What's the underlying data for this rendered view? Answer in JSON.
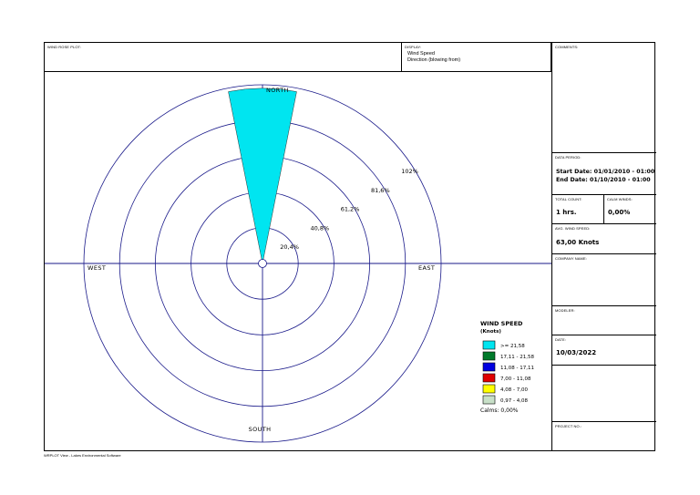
{
  "header": {
    "plot_caption": "WIND ROSE PLOT:",
    "display_caption": "DISPLAY:",
    "display_line1": "Wind Speed",
    "display_line2": "Direction (blowing from)"
  },
  "side": {
    "comments_caption": "COMMENTS:",
    "data_period_caption": "DATA PERIOD:",
    "start_date": "Start Date: 01/01/2010 - 01:00",
    "end_date": "End Date: 01/10/2010 - 01:00",
    "total_count_caption": "TOTAL COUNT:",
    "total_count": "1 hrs.",
    "calm_winds_caption": "CALM WINDS:",
    "calm_winds": "0,00%",
    "avg_speed_caption": "AVG. WIND SPEED:",
    "avg_speed": "63,00 Knots",
    "company_caption": "COMPANY NAME:",
    "modeler_caption": "MODELER:",
    "date_caption": "DATE:",
    "date": "10/03/2022",
    "project_caption": "PROJECT NO.:"
  },
  "footer": "WRPLOT View - Lakes Environmental Software",
  "chart_data": {
    "type": "wind-rose",
    "directions": {
      "north": "NORTH",
      "south": "SOUTH",
      "east": "EAST",
      "west": "WEST"
    },
    "ring_labels": [
      "20,4%",
      "40,8%",
      "61,2%",
      "81,6%",
      "102%"
    ],
    "ring_values": [
      20.4,
      40.8,
      61.2,
      81.6,
      102
    ],
    "max_value": 102,
    "petals": [
      {
        "direction_deg": 0,
        "value": 100,
        "speed_class": ">= 21,58",
        "color": "#00e5f0"
      }
    ],
    "legend": {
      "title": "WIND SPEED",
      "unit": "(Knots)",
      "classes": [
        {
          "label": ">= 21,58",
          "color": "#00e5f0"
        },
        {
          "label": "17,11 - 21,58",
          "color": "#007a2a"
        },
        {
          "label": "11,08 - 17,11",
          "color": "#0000e0"
        },
        {
          "label": "7,00 - 11,08",
          "color": "#e00000"
        },
        {
          "label": "4,08 - 7,00",
          "color": "#ffff00"
        },
        {
          "label": "0,97 - 4,08",
          "color": "#c8e0c8"
        }
      ],
      "calms": "Calms: 0,00%"
    },
    "colors": {
      "axis": "#1a1a8a",
      "rings": "#1a1a8a"
    }
  }
}
